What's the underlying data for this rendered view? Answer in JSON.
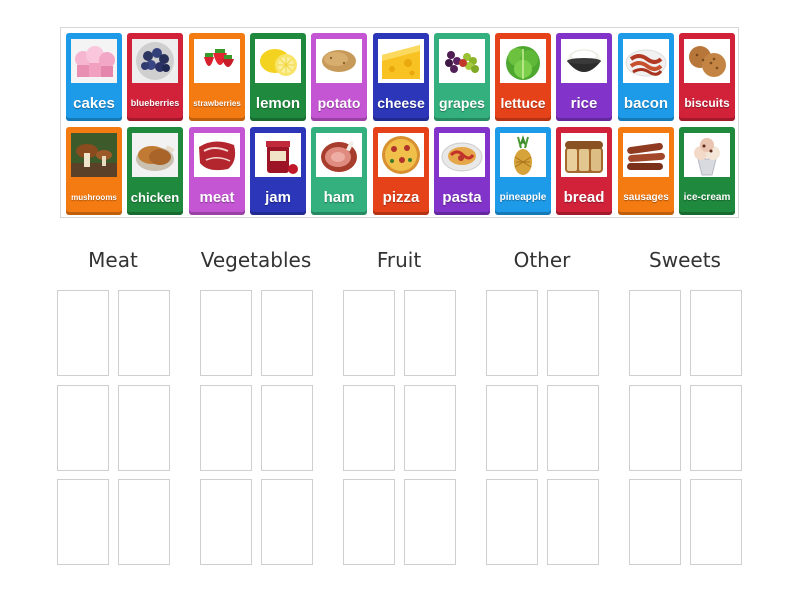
{
  "cards": [
    {
      "id": "cakes",
      "label": "cakes",
      "color": "#1e9be8",
      "icon": "cupcake-icon",
      "size": 15
    },
    {
      "id": "blueberries",
      "label": "blueberries",
      "color": "#d1223a",
      "icon": "blueberries-icon",
      "size": 9
    },
    {
      "id": "strawberries",
      "label": "strawberries",
      "color": "#f47a12",
      "icon": "strawberries-icon",
      "size": 8
    },
    {
      "id": "lemon",
      "label": "lemon",
      "color": "#1f8a3e",
      "icon": "lemon-icon",
      "size": 15
    },
    {
      "id": "potato",
      "label": "potato",
      "color": "#c455d3",
      "icon": "potato-icon",
      "size": 14
    },
    {
      "id": "cheese",
      "label": "cheese",
      "color": "#2b36b8",
      "icon": "cheese-icon",
      "size": 14
    },
    {
      "id": "grapes",
      "label": "grapes",
      "color": "#33b07e",
      "icon": "grapes-icon",
      "size": 14
    },
    {
      "id": "lettuce",
      "label": "lettuce",
      "color": "#e6421a",
      "icon": "lettuce-icon",
      "size": 14
    },
    {
      "id": "rice",
      "label": "rice",
      "color": "#8233c9",
      "icon": "rice-icon",
      "size": 15
    },
    {
      "id": "bacon",
      "label": "bacon",
      "color": "#1e9be8",
      "icon": "bacon-icon",
      "size": 15
    },
    {
      "id": "biscuits",
      "label": "biscuits",
      "color": "#d1223a",
      "icon": "biscuits-icon",
      "size": 12
    },
    {
      "id": "mushrooms",
      "label": "mushrooms",
      "color": "#f47a12",
      "icon": "mushrooms-icon",
      "size": 8
    },
    {
      "id": "chicken",
      "label": "chicken",
      "color": "#1f8a3e",
      "icon": "chicken-icon",
      "size": 13
    },
    {
      "id": "meat",
      "label": "meat",
      "color": "#c455d3",
      "icon": "meat-icon",
      "size": 15
    },
    {
      "id": "jam",
      "label": "jam",
      "color": "#2b36b8",
      "icon": "jam-icon",
      "size": 15
    },
    {
      "id": "ham",
      "label": "ham",
      "color": "#33b07e",
      "icon": "ham-icon",
      "size": 15
    },
    {
      "id": "pizza",
      "label": "pizza",
      "color": "#e6421a",
      "icon": "pizza-icon",
      "size": 15
    },
    {
      "id": "pasta",
      "label": "pasta",
      "color": "#8233c9",
      "icon": "pasta-icon",
      "size": 15
    },
    {
      "id": "pineapple",
      "label": "pineapple",
      "color": "#1e9be8",
      "icon": "pineapple-icon",
      "size": 10
    },
    {
      "id": "bread",
      "label": "bread",
      "color": "#d1223a",
      "icon": "bread-icon",
      "size": 15
    },
    {
      "id": "sausages",
      "label": "sausages",
      "color": "#f47a12",
      "icon": "sausages-icon",
      "size": 10
    },
    {
      "id": "ice-cream",
      "label": "ice-cream",
      "color": "#1f8a3e",
      "icon": "ice-cream-icon",
      "size": 10
    }
  ],
  "groups": [
    {
      "id": "meat",
      "title": "Meat"
    },
    {
      "id": "vegetables",
      "title": "Vegetables"
    },
    {
      "id": "fruit",
      "title": "Fruit"
    },
    {
      "id": "other",
      "title": "Other"
    },
    {
      "id": "sweets",
      "title": "Sweets"
    }
  ]
}
